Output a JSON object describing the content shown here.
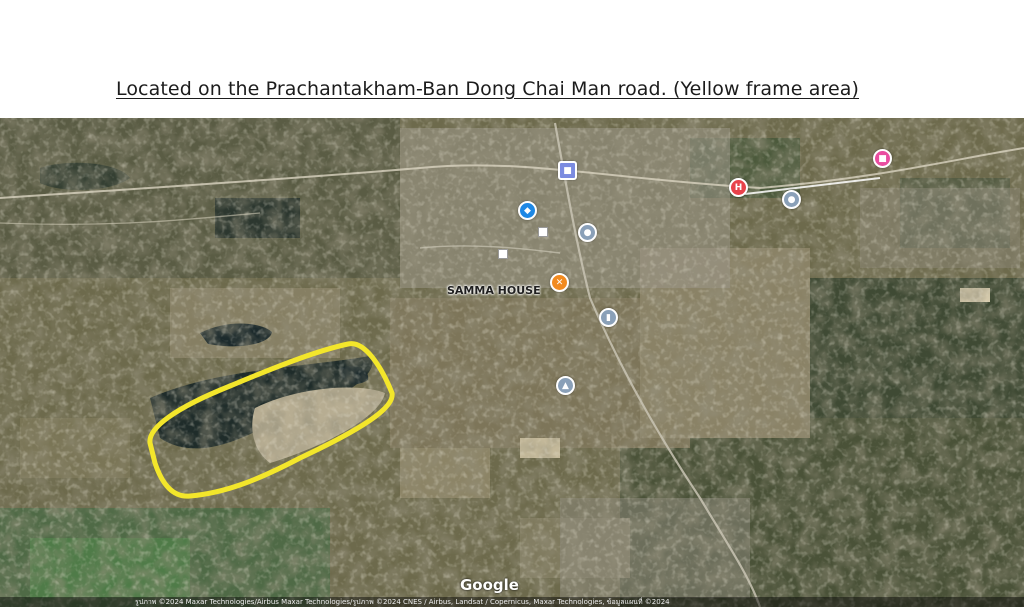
{
  "header": {
    "title": "Located on the Prachantakham-Ban Dong Chai Man road. (Yellow frame area)"
  },
  "map": {
    "place_labels": [
      {
        "text": "SAMMA HOUSE"
      }
    ],
    "pois": [
      {
        "icon": "store-icon",
        "color": "#7b8be0"
      },
      {
        "icon": "shopping-icon",
        "color": "#1e88e5"
      },
      {
        "icon": "place-icon",
        "color": "#8aa0b8"
      },
      {
        "icon": "restaurant-icon",
        "color": "#f28b20"
      },
      {
        "icon": "building-icon",
        "color": "#8aa0b8"
      },
      {
        "icon": "temple-icon",
        "color": "#8aa0b8"
      },
      {
        "icon": "hospital-icon",
        "color": "#e8424b"
      },
      {
        "icon": "place-icon",
        "color": "#8aa0b8"
      },
      {
        "icon": "shop-icon",
        "color": "#e94da0"
      }
    ],
    "frame_color": "#f3e62b",
    "google_logo": "Google",
    "attribution": "รูปภาพ ©2024 Maxar Technologies/Airbus Maxar Technologies/รูปภาพ ©2024 CNES / Airbus, Landsat / Copernicus, Maxar Technologies, ข้อมูลแผนที่ ©2024"
  }
}
